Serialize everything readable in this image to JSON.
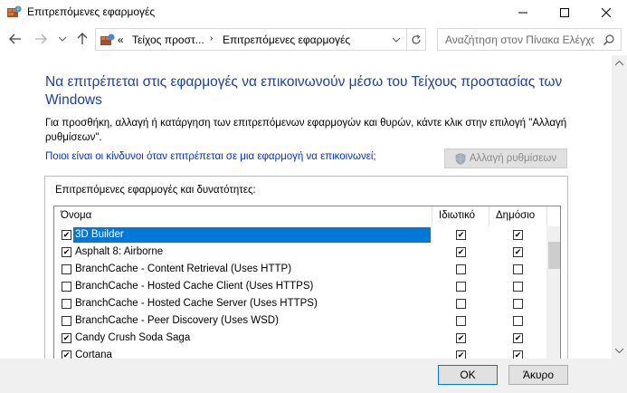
{
  "window": {
    "title": "Επιτρεπόμενες εφαρμογές",
    "icon": "firewall-app-icon"
  },
  "address": {
    "crumbs": [
      "Τείχος προστ...",
      "Επιτρεπόμενες εφαρμογές"
    ],
    "overflow": "«",
    "search_placeholder": "Αναζήτηση στον Πίνακα Ελέγχου"
  },
  "main": {
    "heading": "Να επιτρέπεται στις εφαρμογές να επικοινωνούν μέσω του Τείχους προστασίας των Windows",
    "description": "Για προσθήκη, αλλαγή ή κατάργηση των επιτρεπόμενων εφαρμογών και θυρών, κάντε κλικ στην επιλογή \"Αλλαγή ρυθμίσεων\".",
    "risk_link": "Ποιοι είναι οι κίνδυνοι όταν επιτρέπεται σε μια εφαρμογή να επικοινωνεί;",
    "change_settings": "Αλλαγή ρυθμίσεων",
    "group_label": "Επιτρεπόμενες εφαρμογές και δυνατότητες:"
  },
  "table": {
    "columns": {
      "name": "Όνομα",
      "private": "Ιδιωτικό",
      "public": "Δημόσιο"
    },
    "rows": [
      {
        "name": "3D Builder",
        "enabled": true,
        "private": true,
        "public": true,
        "selected": true
      },
      {
        "name": "Asphalt 8: Airborne",
        "enabled": true,
        "private": true,
        "public": true
      },
      {
        "name": "BranchCache - Content Retrieval (Uses HTTP)",
        "enabled": false,
        "private": false,
        "public": false
      },
      {
        "name": "BranchCache - Hosted Cache Client (Uses HTTPS)",
        "enabled": false,
        "private": false,
        "public": false
      },
      {
        "name": "BranchCache - Hosted Cache Server (Uses HTTPS)",
        "enabled": false,
        "private": false,
        "public": false
      },
      {
        "name": "BranchCache - Peer Discovery (Uses WSD)",
        "enabled": false,
        "private": false,
        "public": false
      },
      {
        "name": "Candy Crush Soda Saga",
        "enabled": true,
        "private": true,
        "public": true
      },
      {
        "name": "Cortana",
        "enabled": true,
        "private": true,
        "public": true
      }
    ]
  },
  "buttons": {
    "ok": "OK",
    "cancel": "Άκυρο"
  },
  "colors": {
    "heading": "#1c3fa0",
    "link": "#0033cc",
    "selection": "#0078d7"
  }
}
